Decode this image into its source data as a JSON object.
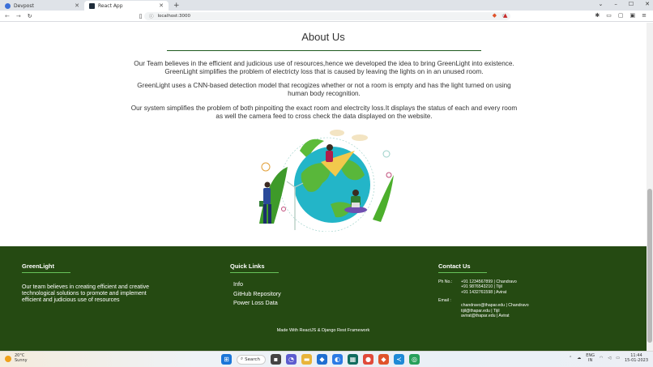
{
  "browser": {
    "tabs": [
      {
        "label": "Devpost",
        "active": false
      },
      {
        "label": "React App",
        "active": true
      }
    ],
    "new_tab_icon": "plus-icon",
    "url": "localhost:3000",
    "window_controls": [
      "minimize-icon",
      "maximize-icon",
      "close-icon"
    ]
  },
  "about": {
    "title": "About Us",
    "paragraphs": [
      "Our Team believes in the efficient and judicious use of resources,hence we developed the idea to bring GreenLight into existence. GreenLight simplifies the problem of electricty loss that is caused by leaving the lights on in an unused room.",
      "GreenLight uses a CNN-based detection model that recogizes whether or not a room is empty and has the light turned on using human body recognition.",
      "Our system simplifies the problem of both pinpoiting the exact room and electrcity loss.It displays the status of each and every room as well the camera feed to cross check the data displayed on the website."
    ]
  },
  "footer": {
    "brand_title": "GreenLight",
    "brand_text": "Our team believes in creating efficient and creative technological solutions to promote and implement efficient and judicious use of resources",
    "quick_links_title": "Quick Links",
    "links": [
      "Info",
      "GitHub Repository",
      "Power Loss Data"
    ],
    "contact_title": "Contact Us",
    "ph_label": "Ph No.:",
    "phones": [
      "+91 1234567899 | Chandravo",
      "+91 9876543210 | Tijil",
      "+91 1432761598 | Avirat"
    ],
    "email_label": "Email :",
    "emails": [
      "chandravo@thapar.edu | Chandravo",
      "tijil@thapar.edu | Tijil",
      "avirat@thapar.edu | Avirat"
    ],
    "made_with": "Made With ReactJS & Django Rest Framework"
  },
  "taskbar": {
    "weather_temp": "20°C",
    "weather_desc": "Sunny",
    "search_label": "Search",
    "lang": "ENG",
    "region": "IN",
    "time": "11:44",
    "date": "15-01-2023"
  },
  "colors": {
    "footer_bg": "#254a12",
    "accent_green": "#67c25a",
    "title_rule": "#1e5a1e"
  }
}
